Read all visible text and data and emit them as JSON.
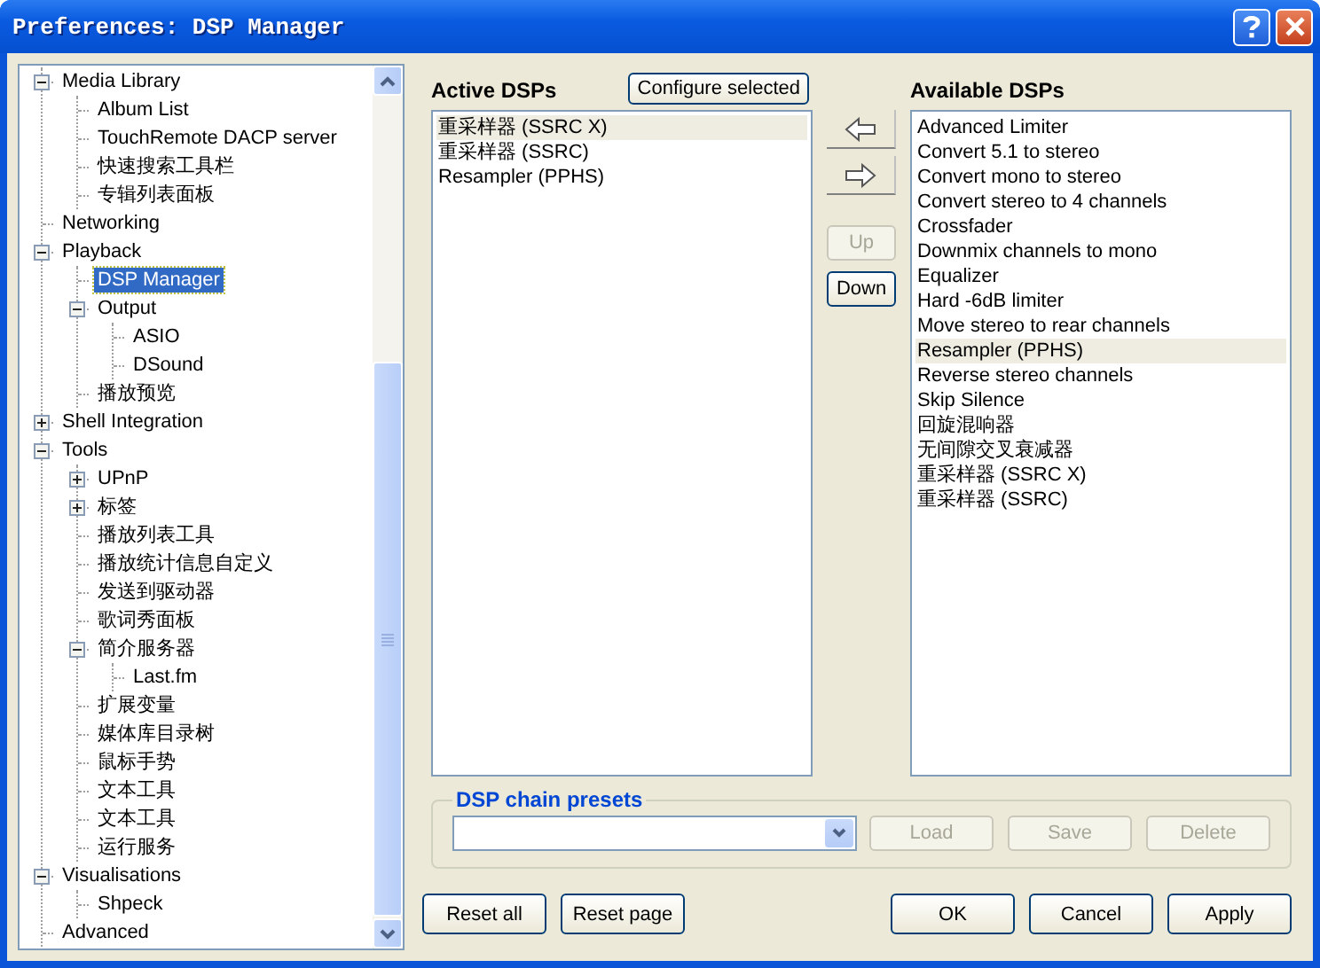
{
  "window": {
    "title": "Preferences: DSP Manager"
  },
  "tree": {
    "items": [
      {
        "label": "Media Library",
        "selected": false,
        "expanded": true,
        "children": [
          {
            "label": "Album List",
            "selected": false
          },
          {
            "label": "TouchRemote DACP server",
            "selected": false
          },
          {
            "label": "快速搜索工具栏",
            "selected": false
          },
          {
            "label": "专辑列表面板",
            "selected": false
          }
        ]
      },
      {
        "label": "Networking",
        "selected": false
      },
      {
        "label": "Playback",
        "selected": false,
        "expanded": true,
        "children": [
          {
            "label": "DSP Manager",
            "selected": true
          },
          {
            "label": "Output",
            "selected": false,
            "expanded": true,
            "children": [
              {
                "label": "ASIO",
                "selected": false
              },
              {
                "label": "DSound",
                "selected": false
              }
            ]
          },
          {
            "label": "播放预览",
            "selected": false
          }
        ]
      },
      {
        "label": "Shell Integration",
        "selected": false,
        "expanded": false
      },
      {
        "label": "Tools",
        "selected": false,
        "expanded": true,
        "children": [
          {
            "label": "UPnP",
            "selected": false,
            "expanded": false
          },
          {
            "label": "标签",
            "selected": false,
            "expanded": false
          },
          {
            "label": "播放列表工具",
            "selected": false
          },
          {
            "label": "播放统计信息自定义",
            "selected": false
          },
          {
            "label": "发送到驱动器",
            "selected": false
          },
          {
            "label": "歌词秀面板",
            "selected": false
          },
          {
            "label": "简介服务器",
            "selected": false,
            "expanded": true,
            "children": [
              {
                "label": "Last.fm",
                "selected": false
              }
            ]
          },
          {
            "label": "扩展变量",
            "selected": false
          },
          {
            "label": "媒体库目录树",
            "selected": false
          },
          {
            "label": "鼠标手势",
            "selected": false
          },
          {
            "label": "文本工具",
            "selected": false
          },
          {
            "label": "文本工具",
            "selected": false
          },
          {
            "label": "运行服务",
            "selected": false
          }
        ]
      },
      {
        "label": "Visualisations",
        "selected": false,
        "expanded": true,
        "children": [
          {
            "label": "Shpeck",
            "selected": false
          }
        ]
      },
      {
        "label": "Advanced",
        "selected": false
      }
    ]
  },
  "active_dsps": {
    "label": "Active DSPs",
    "configure_button": {
      "label": "Configure selected",
      "disabled": false
    },
    "items": [
      {
        "label": "重采样器 (SSRC X)",
        "selected": true
      },
      {
        "label": "重采样器 (SSRC)",
        "selected": false
      },
      {
        "label": "Resampler (PPHS)",
        "selected": false
      }
    ]
  },
  "order_buttons": [
    {
      "label": "Up",
      "disabled": true
    },
    {
      "label": "Down",
      "disabled": false
    }
  ],
  "available_dsps": {
    "label": "Available DSPs",
    "items": [
      {
        "label": "Advanced Limiter",
        "selected": false
      },
      {
        "label": "Convert 5.1 to stereo",
        "selected": false
      },
      {
        "label": "Convert mono to stereo",
        "selected": false
      },
      {
        "label": "Convert stereo to 4 channels",
        "selected": false
      },
      {
        "label": "Crossfader",
        "selected": false
      },
      {
        "label": "Downmix channels to mono",
        "selected": false
      },
      {
        "label": "Equalizer",
        "selected": false
      },
      {
        "label": "Hard -6dB limiter",
        "selected": false
      },
      {
        "label": "Move stereo to rear channels",
        "selected": false
      },
      {
        "label": "Resampler (PPHS)",
        "selected": true
      },
      {
        "label": "Reverse stereo channels",
        "selected": false
      },
      {
        "label": "Skip Silence",
        "selected": false
      },
      {
        "label": "回旋混响器",
        "selected": false
      },
      {
        "label": "无间隙交叉衰减器",
        "selected": false
      },
      {
        "label": "重采样器 (SSRC X)",
        "selected": false
      },
      {
        "label": "重采样器 (SSRC)",
        "selected": false
      }
    ]
  },
  "presets": {
    "title": "DSP chain presets",
    "buttons": [
      {
        "label": "Load",
        "disabled": true
      },
      {
        "label": "Save",
        "disabled": true
      },
      {
        "label": "Delete",
        "disabled": true
      }
    ]
  },
  "footer": {
    "left_buttons": [
      {
        "label": "Reset all",
        "disabled": false
      },
      {
        "label": "Reset page",
        "disabled": false
      }
    ],
    "right_buttons": [
      {
        "label": "OK",
        "disabled": false
      },
      {
        "label": "Cancel",
        "disabled": false
      },
      {
        "label": "Apply",
        "disabled": false
      }
    ]
  }
}
